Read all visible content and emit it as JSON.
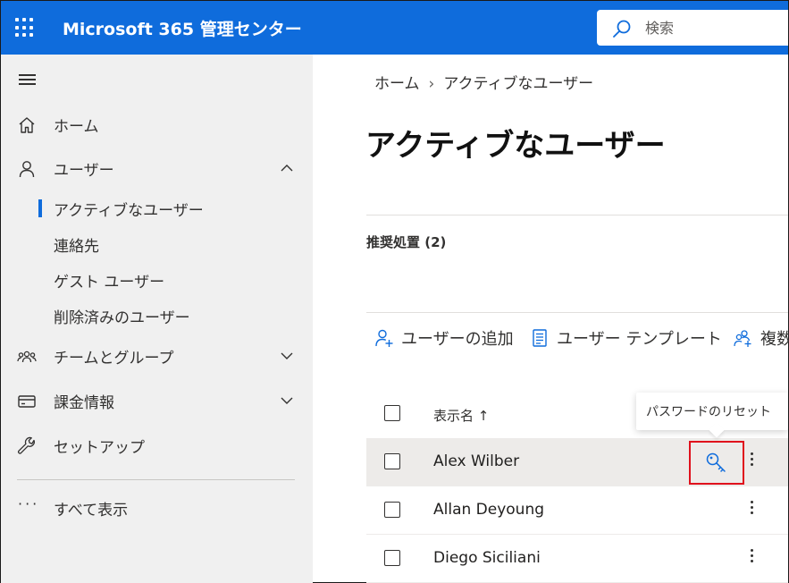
{
  "header": {
    "app_title": "Microsoft 365 管理センター",
    "search_placeholder": "検索"
  },
  "sidebar": {
    "items": [
      {
        "label": "ホーム",
        "icon": "home-icon"
      },
      {
        "label": "ユーザー",
        "icon": "person-icon",
        "expanded": true
      },
      {
        "label": "チームとグループ",
        "icon": "people-team-icon",
        "expanded": false
      },
      {
        "label": "課金情報",
        "icon": "credit-card-icon",
        "expanded": false
      },
      {
        "label": "セットアップ",
        "icon": "wrench-icon"
      }
    ],
    "users_sub": [
      {
        "label": "アクティブなユーザー",
        "selected": true
      },
      {
        "label": "連絡先"
      },
      {
        "label": "ゲスト ユーザー"
      },
      {
        "label": "削除済みのユーザー"
      }
    ],
    "show_all": "すべて表示"
  },
  "breadcrumb": {
    "home": "ホーム",
    "current": "アクティブなユーザー"
  },
  "page": {
    "title": "アクティブなユーザー",
    "recommendations": "推奨処置 (2)"
  },
  "toolbar": {
    "add_user": "ユーザーの追加",
    "user_templates": "ユーザー テンプレート",
    "multiple": "複数"
  },
  "table": {
    "header_name": "表示名 ↑",
    "rows": [
      {
        "name": "Alex Wilber",
        "hovered": true
      },
      {
        "name": "Allan Deyoung"
      },
      {
        "name": "Diego Siciliani"
      }
    ]
  },
  "tooltip": {
    "reset_password": "パスワードのリセット"
  },
  "colors": {
    "brand": "#0f6cdc",
    "highlight_box": "#e0101c",
    "sidebar_bg": "#f0f0f0",
    "selected_row_bg": "#edebe9"
  }
}
